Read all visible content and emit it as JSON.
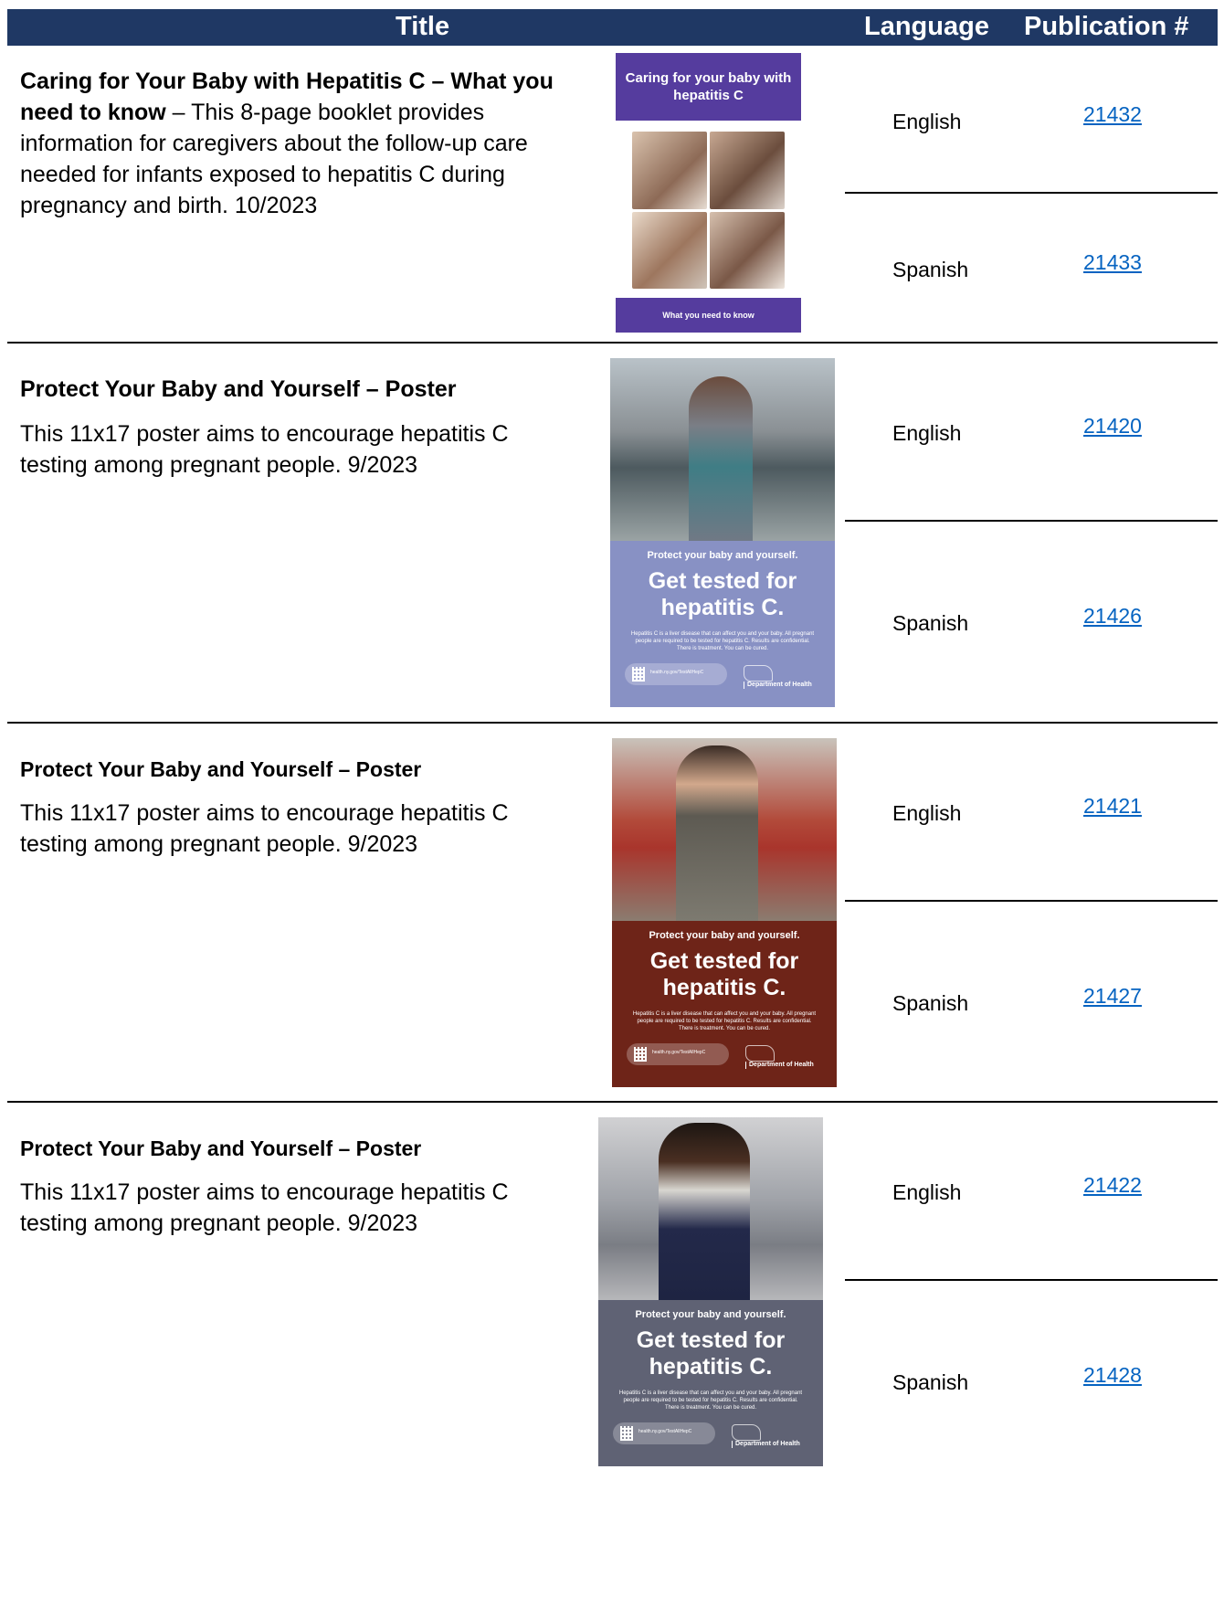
{
  "header": {
    "title": "Title",
    "language": "Language",
    "publication": "Publication #"
  },
  "rows": [
    {
      "title_bold": "Caring for Your Baby with Hepatitis C – What you need to know",
      "title_rest": " – This 8-page booklet provides information for caregivers about the follow-up care needed for infants exposed to hepatitis C during pregnancy and birth. 10/2023",
      "cover": {
        "top_text": "Caring for your baby with hepatitis C",
        "bottom_text": "What you need to know",
        "color": "#553c9e"
      },
      "entries": [
        {
          "language": "English",
          "pub": "21432"
        },
        {
          "language": "Spanish",
          "pub": "21433"
        }
      ]
    },
    {
      "title": "Protect Your Baby and Yourself – Poster",
      "desc": "This 11x17 poster aims to encourage hepatitis C testing among pregnant people. 9/2023",
      "poster": {
        "lead": "Protect your baby and yourself.",
        "head": "Get tested for hepatitis C.",
        "small": "Hepatitis C is a liver disease that can affect you and your baby. All pregnant people are required to be tested for hepatitis C. Results are confidential. There is treatment. You can be cured.",
        "url": "health.ny.gov/TestAllHepC",
        "doh": "Department of Health",
        "color": "#8891c4"
      },
      "entries": [
        {
          "language": "English",
          "pub": "21420"
        },
        {
          "language": "Spanish",
          "pub": "21426"
        }
      ]
    },
    {
      "title": "Protect Your Baby and Yourself – Poster",
      "desc": "This 11x17 poster aims to encourage hepatitis C testing among pregnant people. 9/2023",
      "poster": {
        "lead": "Protect your baby and yourself.",
        "head": "Get tested for hepatitis C.",
        "small": "Hepatitis C is a liver disease that can affect you and your baby. All pregnant people are required to be tested for hepatitis C. Results are confidential. There is treatment. You can be cured.",
        "url": "health.ny.gov/TestAllHepC",
        "doh": "Department of Health",
        "color": "#6e2418"
      },
      "entries": [
        {
          "language": "English",
          "pub": "21421"
        },
        {
          "language": "Spanish",
          "pub": "21427"
        }
      ]
    },
    {
      "title": "Protect Your Baby and Yourself – Poster",
      "desc": "This 11x17 poster aims to encourage hepatitis C testing among pregnant people. 9/2023",
      "poster": {
        "lead": "Protect your baby and yourself.",
        "head": "Get tested for hepatitis C.",
        "small": "Hepatitis C is a liver disease that can affect you and your baby. All pregnant people are required to be tested for hepatitis C. Results are confidential. There is treatment. You can be cured.",
        "url": "health.ny.gov/TestAllHepC",
        "doh": "Department of Health",
        "color": "#5f6274"
      },
      "entries": [
        {
          "language": "English",
          "pub": "21422"
        },
        {
          "language": "Spanish",
          "pub": "21428"
        }
      ]
    }
  ]
}
